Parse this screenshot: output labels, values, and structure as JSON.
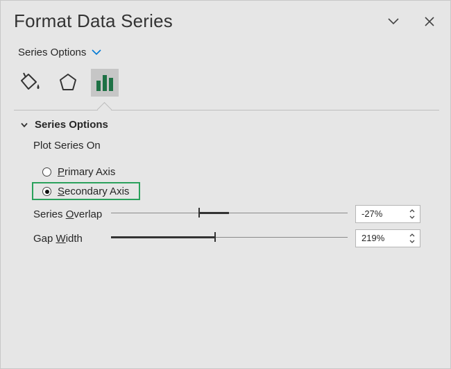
{
  "pane": {
    "title": "Format Data Series",
    "collapse_icon": "chevron-down-icon",
    "close_icon": "close-icon",
    "subtitle": "Series Options",
    "tabs": [
      {
        "name": "fill-line",
        "icon": "paint-bucket-icon",
        "selected": false
      },
      {
        "name": "effects",
        "icon": "pentagon-icon",
        "selected": false
      },
      {
        "name": "series-options",
        "icon": "bar-chart-icon",
        "selected": true
      }
    ]
  },
  "section": {
    "title": "Series Options",
    "plot_on_label": "Plot Series On",
    "radios": [
      {
        "label_first": "P",
        "label_rest": "rimary Axis",
        "checked": false
      },
      {
        "label_first": "S",
        "label_rest": "econdary Axis",
        "checked": true
      }
    ],
    "overlap": {
      "label_pre": "Series ",
      "label_u": "O",
      "label_post": "verlap",
      "value": "-27%",
      "percent": -27
    },
    "gap": {
      "label_pre": "Gap ",
      "label_u": "W",
      "label_post": "idth",
      "value": "219%",
      "percent": 219
    }
  },
  "colors": {
    "highlight": "#2aa15c",
    "chart_icon": "#1e7145",
    "accent": "#0078d4"
  }
}
